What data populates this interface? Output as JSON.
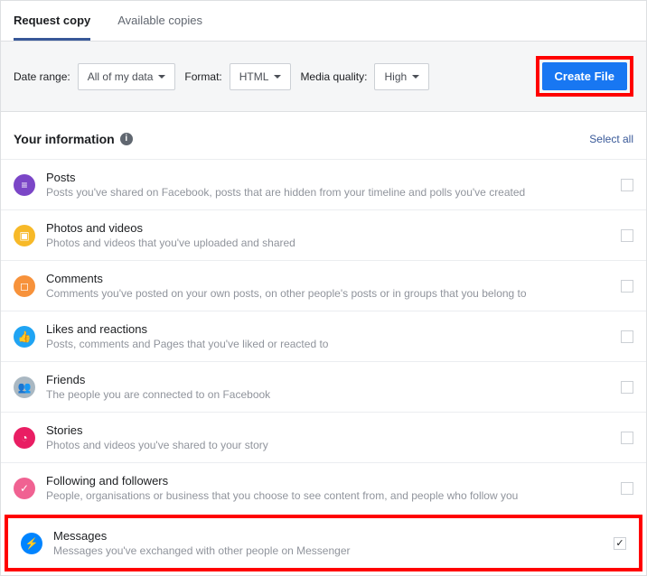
{
  "tabs": {
    "request": "Request copy",
    "available": "Available copies"
  },
  "controls": {
    "dateRangeLabel": "Date range:",
    "dateRangeValue": "All of my data",
    "formatLabel": "Format:",
    "formatValue": "HTML",
    "mediaQualityLabel": "Media quality:",
    "mediaQualityValue": "High",
    "createFile": "Create File"
  },
  "section": {
    "title": "Your information",
    "selectAll": "Select all"
  },
  "items": [
    {
      "title": "Posts",
      "desc": "Posts you've shared on Facebook, posts that are hidden from your timeline and polls you've created",
      "color": "#7b46c7",
      "checked": false
    },
    {
      "title": "Photos and videos",
      "desc": "Photos and videos that you've uploaded and shared",
      "color": "#f7b928",
      "checked": false
    },
    {
      "title": "Comments",
      "desc": "Comments you've posted on your own posts, on other people's posts or in groups that you belong to",
      "color": "#f7923b",
      "checked": false
    },
    {
      "title": "Likes and reactions",
      "desc": "Posts, comments and Pages that you've liked or reacted to",
      "color": "#20a4f3",
      "checked": false
    },
    {
      "title": "Friends",
      "desc": "The people you are connected to on Facebook",
      "color": "#aab8c2",
      "checked": false
    },
    {
      "title": "Stories",
      "desc": "Photos and videos you've shared to your story",
      "color": "#e91e63",
      "checked": false
    },
    {
      "title": "Following and followers",
      "desc": "People, organisations or business that you choose to see content from, and people who follow you",
      "color": "#f06292",
      "checked": false
    },
    {
      "title": "Messages",
      "desc": "Messages you've exchanged with other people on Messenger",
      "color": "#0084ff",
      "checked": true
    }
  ]
}
